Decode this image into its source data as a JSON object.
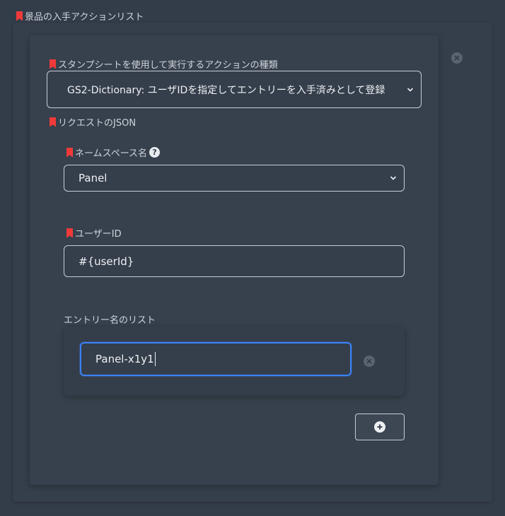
{
  "rewards": {
    "label": "景品の入手アクションリスト"
  },
  "action": {
    "label": "スタンプシートを使用して実行するアクションの種類",
    "selected": "GS2-Dictionary: ユーザIDを指定してエントリーを入手済みとして登録"
  },
  "request": {
    "label": "リクエストのJSON",
    "namespace": {
      "label": "ネームスペース名",
      "help_glyph": "?",
      "selected": "Panel"
    },
    "user_id": {
      "label": "ユーザーID",
      "value": "#{userId}"
    },
    "entries": {
      "label": "エントリー名のリスト",
      "items": [
        "Panel-x1y1"
      ]
    }
  },
  "icons": {
    "remove": "close-circle-icon",
    "add": "plus-circle-icon",
    "required": "bookmark-icon",
    "help": "question-circle-icon"
  },
  "colors": {
    "background": "#333c49",
    "required_marker": "#ef3a3a",
    "focus_border": "#3b82f6"
  }
}
